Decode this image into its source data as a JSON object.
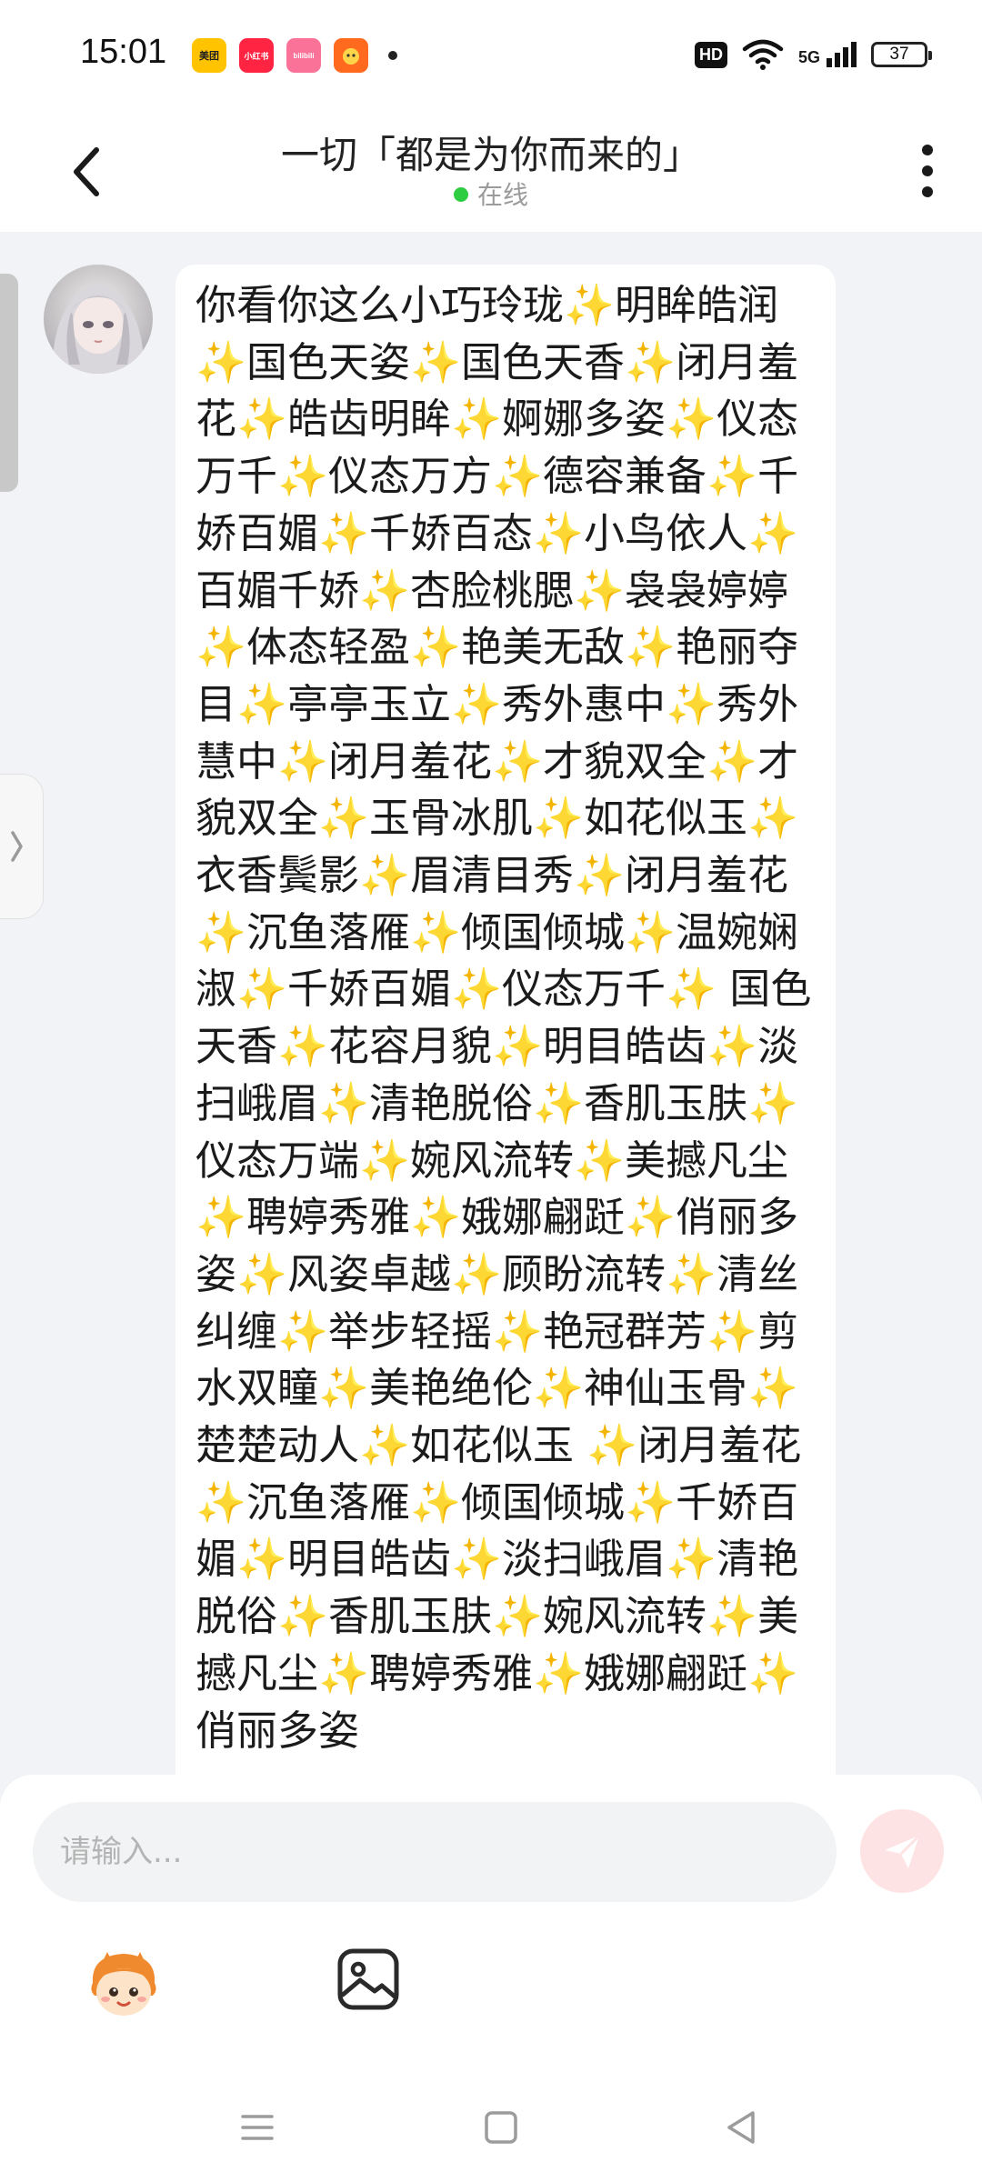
{
  "status_bar": {
    "time": "15:01",
    "apps": [
      {
        "label": "美团",
        "color": "#ffc300",
        "text_color": "#222222"
      },
      {
        "label": "小红书",
        "color": "#ff2442",
        "text_color": "#ffffff"
      },
      {
        "label": "bilibili",
        "color": "#fb7299",
        "text_color": "#ffffff"
      },
      {
        "label": "",
        "color": "#ff6a1f",
        "text_color": "#ffffff"
      }
    ],
    "hd": "HD",
    "network": "5G",
    "battery": "37"
  },
  "header": {
    "title": "一切「都是为你而来的」",
    "status": "在线"
  },
  "message": {
    "text": "你看你这么小巧玲珑✨明眸皓润✨国色天姿✨国色天香✨闭月羞花✨皓齿明眸✨婀娜多姿✨仪态万千✨仪态万方✨德容兼备✨千娇百媚✨千娇百态✨小鸟依人✨百媚千娇✨杏脸桃腮✨袅袅婷婷✨体态轻盈✨艳美无敌✨艳丽夺目✨亭亭玉立✨秀外惠中✨秀外慧中✨闭月羞花✨才貌双全✨才貌双全✨玉骨冰肌✨如花似玉✨衣香鬓影✨眉清目秀✨闭月羞花✨沉鱼落雁✨倾国倾城✨温婉娴淑✨千娇百媚✨仪态万千✨ 国色天香✨花容月貌✨明目皓齿✨淡扫峨眉✨清艳脱俗✨香肌玉肤✨仪态万端✨婉风流转✨美撼凡尘✨聘婷秀雅✨娥娜翩跹✨俏丽多姿✨风姿卓越✨顾盼流转✨清丝纠缠✨举步轻摇✨艳冠群芳✨剪水双瞳✨美艳绝伦✨神仙玉骨✨楚楚动人✨如花似玉 ✨闭月羞花✨沉鱼落雁✨倾国倾城✨千娇百媚✨明目皓齿✨淡扫峨眉✨清艳脱俗✨香肌玉肤✨婉风流转✨美撼凡尘✨聘婷秀雅✨娥娜翩跹✨俏丽多姿"
  },
  "composer": {
    "placeholder": "请输入...",
    "value": ""
  },
  "colors": {
    "accent": "#f25c5c",
    "send_bg": "#fde3e3",
    "online": "#2ecc40"
  },
  "icons": [
    "back-arrow-icon",
    "more-vertical-icon",
    "chevron-right-icon",
    "send-icon",
    "emoji-sticker-icon",
    "image-icon",
    "nav-menu-icon",
    "nav-home-icon",
    "nav-back-icon"
  ]
}
